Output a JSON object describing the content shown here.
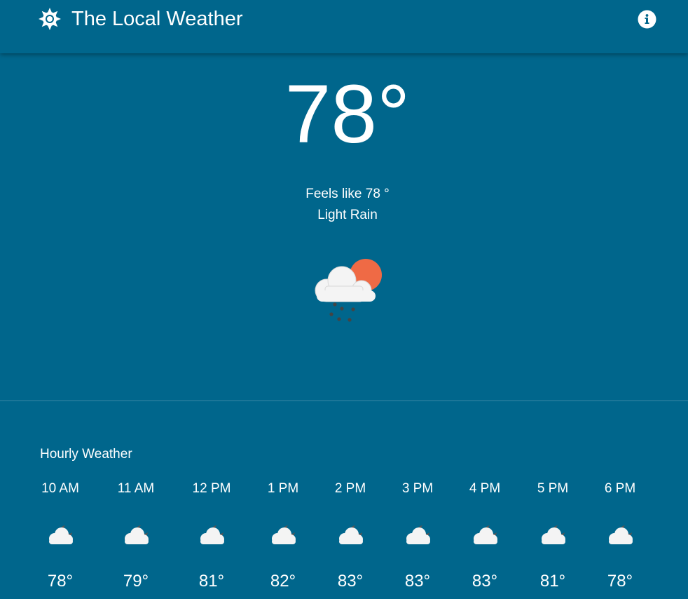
{
  "app": {
    "title": "The Local Weather",
    "logo_icon": "sun-gear-icon",
    "info_icon": "info-icon"
  },
  "current": {
    "temperature": "78°",
    "feels_like": "Feels like 78 °",
    "condition": "Light Rain",
    "icon": "cloud-sun-rain-icon"
  },
  "hourly": {
    "title": "Hourly Weather",
    "hours": [
      {
        "time": "10 AM",
        "temp": "78°",
        "icon": "cloud-moon-icon"
      },
      {
        "time": "11 AM",
        "temp": "79°",
        "icon": "cloud-moon-icon"
      },
      {
        "time": "12 PM",
        "temp": "81°",
        "icon": "cloud-moon-icon"
      },
      {
        "time": "1 PM",
        "temp": "82°",
        "icon": "cloud-moon-icon"
      },
      {
        "time": "2 PM",
        "temp": "83°",
        "icon": "cloud-moon-icon"
      },
      {
        "time": "3 PM",
        "temp": "83°",
        "icon": "cloud-moon-icon"
      },
      {
        "time": "4 PM",
        "temp": "83°",
        "icon": "cloud-moon-icon"
      },
      {
        "time": "5 PM",
        "temp": "81°",
        "icon": "cloud-moon-icon"
      },
      {
        "time": "6 PM",
        "temp": "78°",
        "icon": "cloud-moon-icon"
      }
    ]
  },
  "colors": {
    "background": "#00668c",
    "text": "#ffffff",
    "sun": "#ef6a45",
    "cloud": "#f2f2f2",
    "dark_cloud": "#555555"
  }
}
